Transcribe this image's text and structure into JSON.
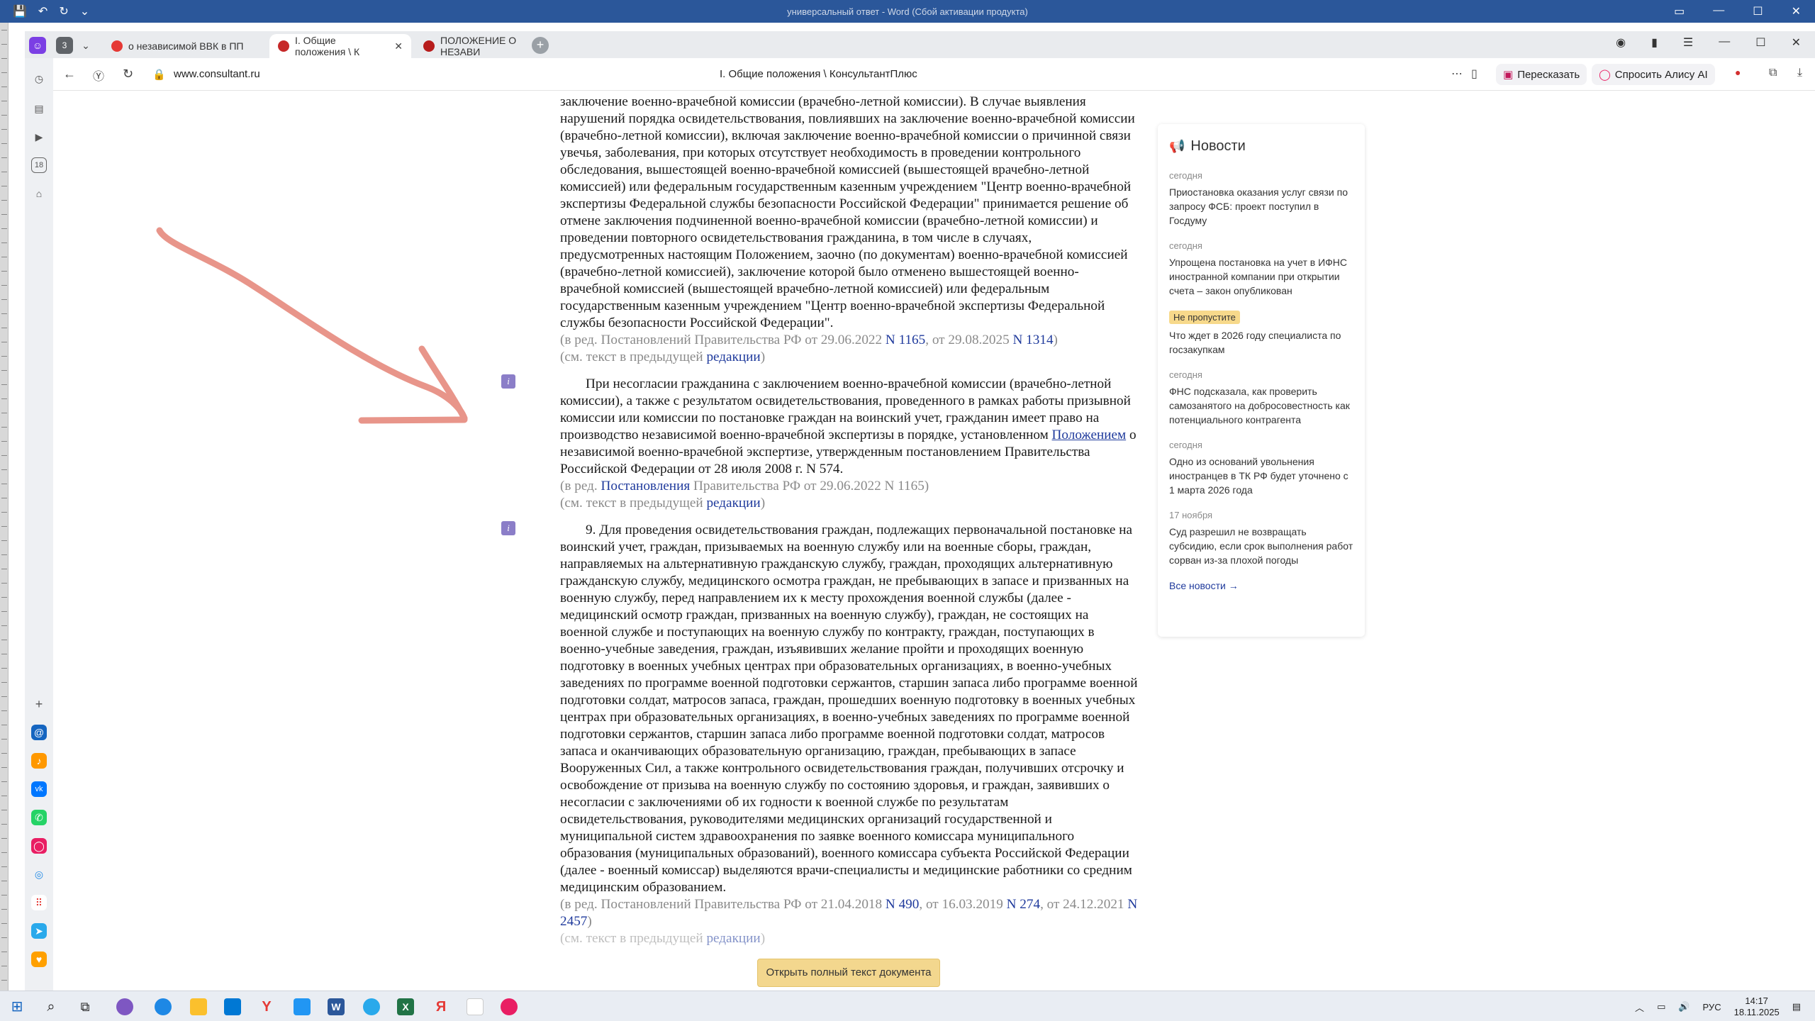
{
  "word": {
    "title": "универсальный ответ - Word (Сбой активации продукта)"
  },
  "tabs": [
    {
      "label": "о независимой ВВК в ПП",
      "color": "#e53935"
    },
    {
      "label": "I. Общие положения \\ К",
      "color": "#c62828"
    },
    {
      "label": "ПОЛОЖЕНИЕ О НЕЗАВИ",
      "color": "#b71c1c"
    }
  ],
  "tab_group_count": "3",
  "address": {
    "url": "www.consultant.ru",
    "title": "I. Общие положения \\ КонсультантПлюс"
  },
  "addr_buttons": {
    "retell": "Пересказать",
    "alice": "Спросить Алису AI"
  },
  "doc": {
    "p1": "заключение военно-врачебной комиссии (врачебно-летной комиссии). В случае выявления нарушений порядка освидетельствования, повлиявших на заключение военно-врачебной комиссии (врачебно-летной комиссии), включая заключение военно-врачебной комиссии о причинной связи увечья, заболевания, при которых отсутствует необходимость в проведении контрольного обследования, вышестоящей военно-врачебной комиссией (вышестоящей врачебно-летной комиссией) или федеральным государственным казенным учреждением \"Центр военно-врачебной экспертизы Федеральной службы безопасности Российской Федерации\" принимается решение об отмене заключения подчиненной военно-врачебной комиссии (врачебно-летной комиссии) и проведении повторного освидетельствования гражданина, в том числе в случаях, предусмотренных настоящим Положением, заочно (по документам) военно-врачебной комиссией (врачебно-летной комиссией), заключение которой было отменено вышестоящей военно-врачебной комиссией (вышестоящей врачебно-летной комиссией) или федеральным государственным казенным учреждением \"Центр военно-врачебной экспертизы Федеральной службы безопасности Российской Федерации\".",
    "ed1_pre": "(в ред. Постановлений Правительства РФ от 29.06.2022 ",
    "ed1_link1": "N 1165",
    "ed1_mid": ", от 29.08.2025 ",
    "ed1_link2": "N 1314",
    "ed1_post": ")",
    "prev_pre": "(см. текст в предыдущей ",
    "prev_link": "редакции",
    "prev_post": ")",
    "p2_pre": "При несогласии гражданина с заключением военно-врачебной комиссии (врачебно-летной комиссии), а также с результатом освидетельствования, проведенного в рамках работы призывной комиссии или комиссии по постановке граждан на воинский учет, гражданин имеет право на производство независимой военно-врачебной экспертизы в порядке, установленном ",
    "p2_link": "Положением",
    "p2_post": " о независимой военно-врачебной экспертизе, утвержденным постановлением Правительства Российской Федерации от 28 июля 2008 г. N 574.",
    "ed2_pre": "(в ред. ",
    "ed2_link": "Постановления",
    "ed2_post": " Правительства РФ от 29.06.2022 N 1165)",
    "p3": "9. Для проведения освидетельствования граждан, подлежащих первоначальной постановке на воинский учет, граждан, призываемых на военную службу или на военные сборы, граждан, направляемых на альтернативную гражданскую службу, граждан, проходящих альтернативную гражданскую службу, медицинского осмотра граждан, не пребывающих в запасе и призванных на военную службу, перед направлением их к месту прохождения военной службы (далее - медицинский осмотр граждан, призванных на военную службу), граждан, не состоящих на военной службе и поступающих на военную службу по контракту, граждан, поступающих в военно-учебные заведения, граждан, изъявивших желание пройти и проходящих военную подготовку в военных учебных центрах при образовательных организациях, в военно-учебных заведениях по программе военной подготовки сержантов, старшин запаса либо программе военной подготовки солдат, матросов запаса, граждан, прошедших военную подготовку в военных учебных центрах при образовательных организациях, в военно-учебных заведениях по программе военной подготовки сержантов, старшин запаса либо программе военной подготовки солдат, матросов запаса и оканчивающих образовательную организацию, граждан, пребывающих в запасе Вооруженных Сил, а также контрольного освидетельствования граждан, получивших отсрочку и освобождение от призыва на военную службу по состоянию здоровья, и граждан, заявивших о несогласии с заключениями об их годности к военной службе по результатам освидетельствования, руководителями медицинских организаций государственной и муниципальной систем здравоохранения по заявке военного комиссара муниципального образования (муниципальных образований), военного комиссара субъекта Российской Федерации (далее - военный комиссар) выделяются врачи-специалисты и медицинские работники со средним медицинским образованием.",
    "ed3_pre": "(в ред. Постановлений Правительства РФ от 21.04.2018 ",
    "ed3_link1": "N 490",
    "ed3_mid1": ", от 16.03.2019 ",
    "ed3_link2": "N 274",
    "ed3_mid2": ", от 24.12.2021 ",
    "ed3_link3": "N 2457",
    "ed3_post": ")"
  },
  "news": {
    "title": "Новости",
    "items": [
      {
        "date": "сегодня",
        "text": "Приостановка оказания услуг связи по запросу ФСБ: проект поступил в Госдуму"
      },
      {
        "date": "сегодня",
        "text": "Упрощена постановка на учет в ИФНС иностранной компании при открытии счета – закон опубликован"
      },
      {
        "badge": "Не пропустите",
        "text": "Что ждет в 2026 году специалиста по госзакупкам"
      },
      {
        "date": "сегодня",
        "text": "ФНС подсказала, как проверить самозанятого на добросовестность как потенциального контрагента"
      },
      {
        "date": "сегодня",
        "text": "Одно из оснований увольнения иностранцев в ТК РФ будет уточнено с 1 марта 2026 года"
      },
      {
        "date": "17 ноября",
        "text": "Суд разрешил не возвращать субсидию, если срок выполнения работ сорван из-за плохой погоды"
      }
    ],
    "all_link": "Все новости →"
  },
  "open_button": "Открыть полный текст документа",
  "tray": {
    "lang": "РУС",
    "time": "14:17",
    "date": "18.11.2025"
  },
  "colors": {
    "link": "#1f3a9c",
    "annotation_arrow": "#e8958a",
    "button": "#f3d78e"
  }
}
